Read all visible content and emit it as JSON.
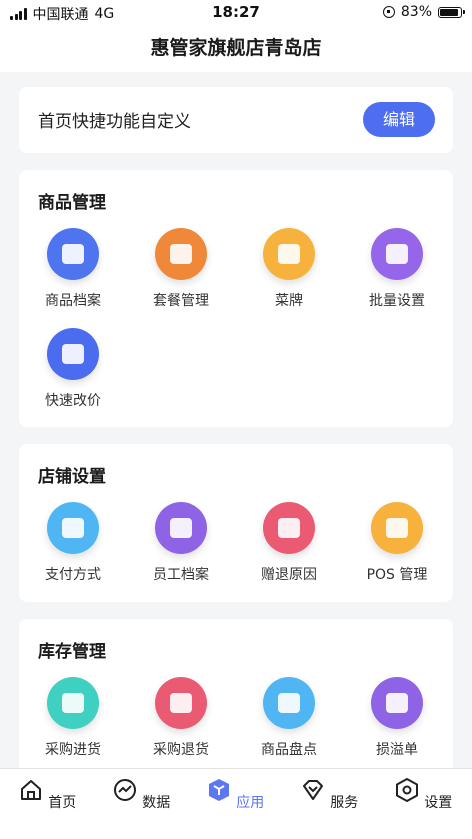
{
  "status_bar": {
    "carrier": "中国联通",
    "network": "4G",
    "time": "18:27",
    "battery": "83%"
  },
  "header": {
    "title": "惠管家旗舰店青岛店"
  },
  "shortcut": {
    "title": "首页快捷功能自定义",
    "edit_label": "编辑"
  },
  "sections": [
    {
      "title": "商品管理",
      "items": [
        {
          "label": "商品档案",
          "icon": "product-file-icon",
          "color": "#4f74f0"
        },
        {
          "label": "套餐管理",
          "icon": "package-icon",
          "color": "#f0883a"
        },
        {
          "label": "菜牌",
          "icon": "menu-card-icon",
          "color": "#f6b23d"
        },
        {
          "label": "批量设置",
          "icon": "batch-settings-icon",
          "color": "#9666ea"
        },
        {
          "label": "快速改价",
          "icon": "quick-price-icon",
          "color": "#4c6cf0"
        }
      ]
    },
    {
      "title": "店铺设置",
      "items": [
        {
          "label": "支付方式",
          "icon": "payment-card-icon",
          "color": "#4fb6f3"
        },
        {
          "label": "员工档案",
          "icon": "staff-icon",
          "color": "#8f63e6"
        },
        {
          "label": "赠退原因",
          "icon": "return-reason-icon",
          "color": "#ea5a73"
        },
        {
          "label": "POS 管理",
          "icon": "pos-icon",
          "color": "#f6b23d"
        }
      ]
    },
    {
      "title": "库存管理",
      "items": [
        {
          "label": "采购进货",
          "icon": "purchase-in-icon",
          "color": "#3fd0c2"
        },
        {
          "label": "采购退货",
          "icon": "purchase-return-icon",
          "color": "#ea5a73"
        },
        {
          "label": "商品盘点",
          "icon": "stocktake-icon",
          "color": "#4fb6f3"
        },
        {
          "label": "损溢单",
          "icon": "loss-report-icon",
          "color": "#8f63e6"
        }
      ]
    }
  ],
  "tabbar": {
    "active_color": "#5b77f2",
    "items": [
      {
        "label": "首页",
        "icon": "home-icon"
      },
      {
        "label": "数据",
        "icon": "chart-icon"
      },
      {
        "label": "应用",
        "icon": "cube-icon"
      },
      {
        "label": "服务",
        "icon": "service-icon"
      },
      {
        "label": "设置",
        "icon": "settings-icon"
      }
    ]
  }
}
